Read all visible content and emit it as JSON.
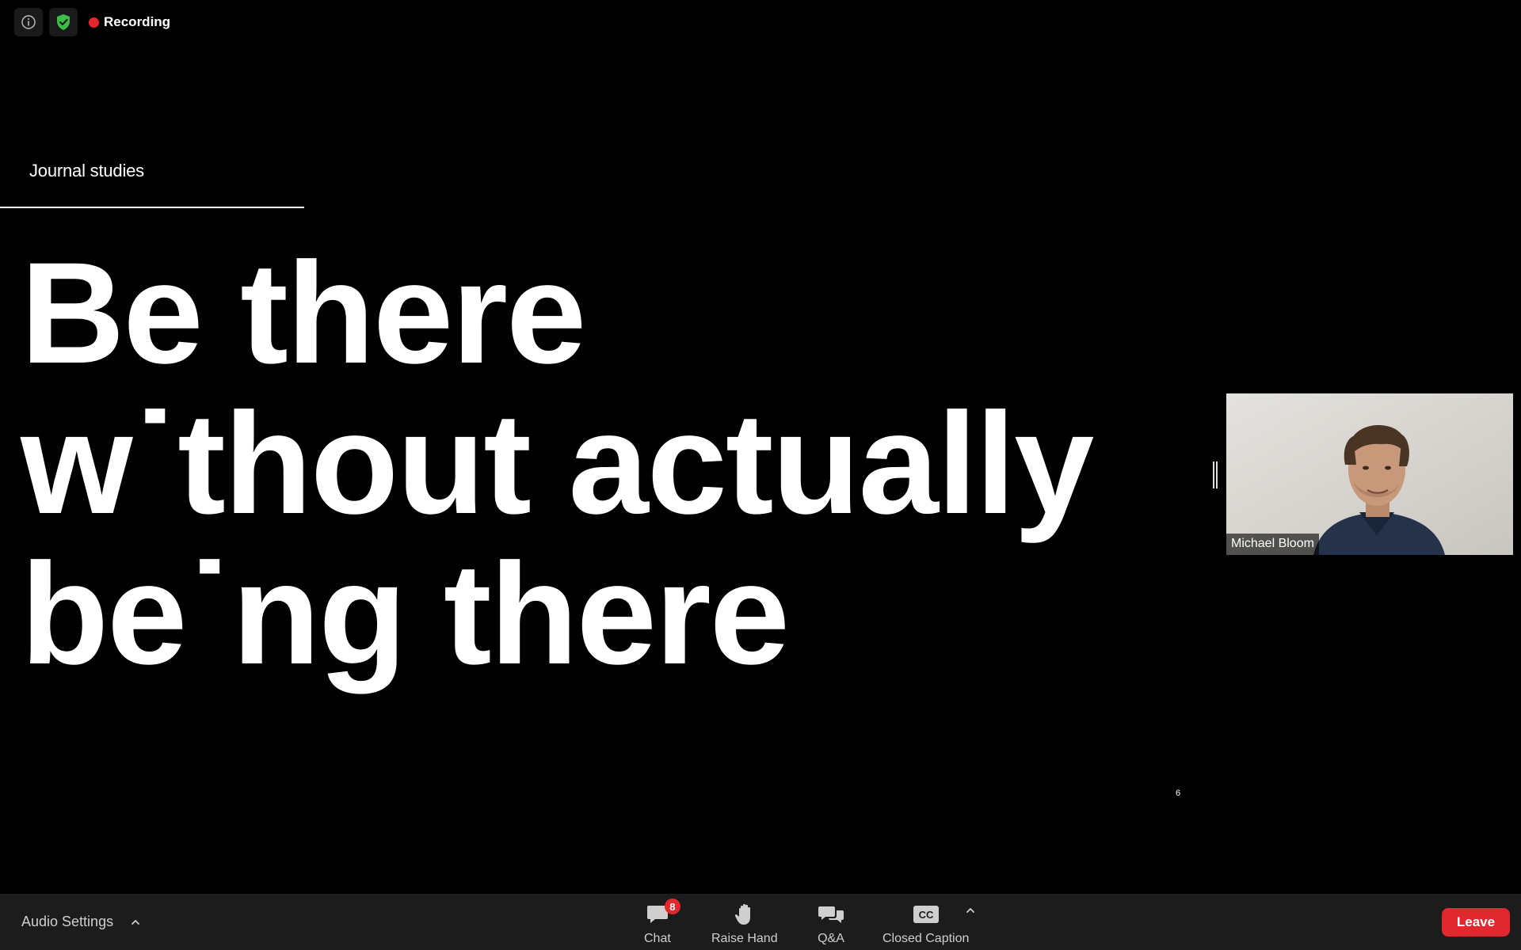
{
  "meeting": {
    "recording_label": "Recording",
    "colors": {
      "recording": "#e5252c",
      "encryption": "#3cbf46",
      "leave": "#e0282e",
      "toolbar_bg": "#1c1c1c"
    }
  },
  "slide": {
    "section": "Journal studies",
    "headline": {
      "line1": "Be there",
      "line2": "w˙thout actually",
      "line3": "be˙ng there"
    },
    "page_number": "6"
  },
  "participant": {
    "name": "Michael Bloom"
  },
  "toolbar": {
    "audio_settings_label": "Audio Settings",
    "chat_label": "Chat",
    "chat_badge": "8",
    "raise_hand_label": "Raise Hand",
    "qa_label": "Q&A",
    "closed_caption_label": "Closed Caption",
    "cc_icon_text": "CC",
    "leave_label": "Leave"
  },
  "icons": {
    "info": "info-icon",
    "security": "shield-check-icon",
    "chat": "chat-bubble-icon",
    "raise_hand": "hand-icon",
    "qa": "qa-bubbles-icon",
    "closed_caption": "cc-icon",
    "chevron": "chevron-up-icon"
  }
}
